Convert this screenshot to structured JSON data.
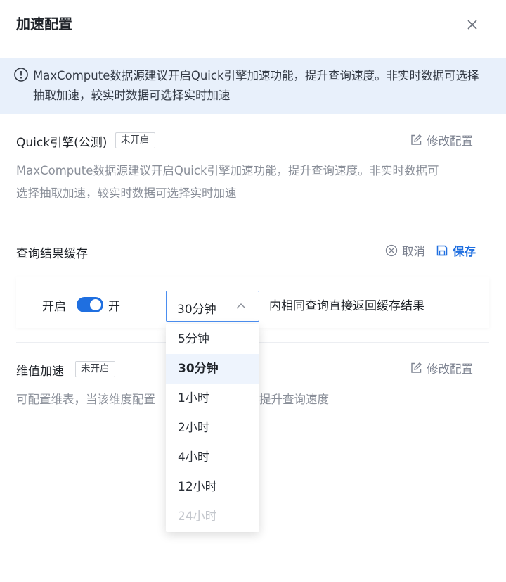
{
  "dialog": {
    "title": "加速配置"
  },
  "notice": {
    "text": "MaxCompute数据源建议开启Quick引擎加速功能，提升查询速度。非实时数据可选择抽取加速，较实时数据可选择实时加速"
  },
  "quick_engine": {
    "title": "Quick引擎(公测)",
    "badge": "未开启",
    "edit_label": "修改配置",
    "description_line1": "MaxCompute数据源建议开启Quick引擎加速功能，提升查询速度。非实时数据可",
    "description_line2": "选择抽取加速，较实时数据可选择实时加速"
  },
  "result_cache": {
    "title": "查询结果缓存",
    "cancel_label": "取消",
    "save_label": "保存",
    "enable_label": "开启",
    "switch_on": true,
    "switch_text": "开",
    "selected_duration": "30分钟",
    "suffix": "内相同查询直接返回缓存结果"
  },
  "dimension_accel": {
    "title": "维值加速",
    "badge": "未开启",
    "edit_label": "修改配置",
    "description_visible_left": "可配置维表，当该维度配置",
    "description_visible_right": "提升查询速度"
  },
  "duration_options": [
    {
      "label": "5分钟",
      "selected": false,
      "disabled": false
    },
    {
      "label": "30分钟",
      "selected": true,
      "disabled": false
    },
    {
      "label": "1小时",
      "selected": false,
      "disabled": false
    },
    {
      "label": "2小时",
      "selected": false,
      "disabled": false
    },
    {
      "label": "4小时",
      "selected": false,
      "disabled": false
    },
    {
      "label": "12小时",
      "selected": false,
      "disabled": false
    },
    {
      "label": "24小时",
      "selected": false,
      "disabled": true
    }
  ],
  "colors": {
    "accent": "#1f6fe0",
    "notice_bg": "#e8f0fb",
    "muted_text": "#8a8f99"
  }
}
